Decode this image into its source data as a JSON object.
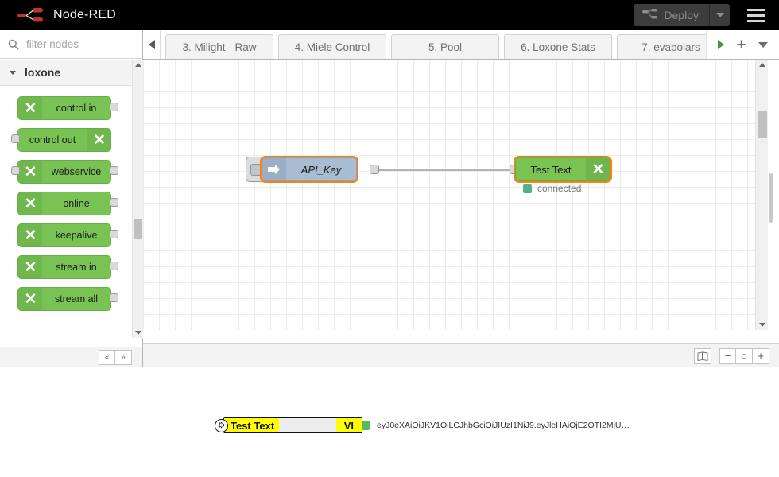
{
  "header": {
    "brand_title": "Node-RED",
    "logo_icon": "node-red-logo-icon",
    "deploy_label": "Deploy",
    "deploy_icon": "deploy-nodes-icon",
    "deploy_caret_icon": "chevron-down-icon",
    "menu_icon": "hamburger-menu-icon",
    "background_color": "#000000",
    "deploy_button_color": "#3c3c3c",
    "deploy_text_color": "#8d8d8d"
  },
  "palette": {
    "search": {
      "placeholder": "filter nodes",
      "value": "",
      "icon": "search-icon"
    },
    "category": {
      "label": "loxone",
      "chevron_icon": "chevron-down-icon",
      "expanded": true
    },
    "node_color": "#78c353",
    "nodes": [
      {
        "label": "control in",
        "icon": "loxone-x-icon",
        "icon_side": "left",
        "has_input": false,
        "has_output": true
      },
      {
        "label": "control out",
        "icon": "loxone-x-icon",
        "icon_side": "right",
        "has_input": true,
        "has_output": false
      },
      {
        "label": "webservice",
        "icon": "loxone-x-icon",
        "icon_side": "left",
        "has_input": true,
        "has_output": true
      },
      {
        "label": "online",
        "icon": "loxone-x-icon",
        "icon_side": "left",
        "has_input": false,
        "has_output": true
      },
      {
        "label": "keepalive",
        "icon": "loxone-x-icon",
        "icon_side": "left",
        "has_input": false,
        "has_output": true
      },
      {
        "label": "stream in",
        "icon": "loxone-x-icon",
        "icon_side": "left",
        "has_input": false,
        "has_output": true
      },
      {
        "label": "stream all",
        "icon": "loxone-x-icon",
        "icon_side": "left",
        "has_input": false,
        "has_output": true
      }
    ],
    "footer": {
      "collapse_all_label": "«",
      "expand_all_label": "»",
      "collapse_all_icon": "collapse-all-icon",
      "expand_all_icon": "expand-all-icon"
    },
    "scrollbar": {
      "up_icon": "scroll-up-arrow-icon",
      "down_icon": "scroll-down-arrow-icon"
    }
  },
  "tabbar": {
    "scroll_left_icon": "scroll-left-arrow-icon",
    "scroll_right_icon": "scroll-right-arrow-icon",
    "tabs": [
      {
        "label": "3. Milight - Raw",
        "active": false
      },
      {
        "label": "4. Miele Control",
        "active": false
      },
      {
        "label": "5. Pool",
        "active": false
      },
      {
        "label": "6. Loxone Stats",
        "active": false
      },
      {
        "label": "7. evapolars",
        "active": false,
        "clipped": true
      }
    ],
    "add_tab_label": "+",
    "add_tab_icon": "plus-icon",
    "tab_menu_icon": "chevron-down-icon"
  },
  "canvas": {
    "grid_size_px": 20,
    "nodes": [
      {
        "id": "inject",
        "label": "API_Key",
        "type": "inject",
        "color": "#a8bcd2",
        "icon": "inject-arrow-icon",
        "selected": true,
        "italic": true,
        "button_icon": "inject-trigger-button-icon"
      },
      {
        "id": "debug",
        "label": "Test Text",
        "type": "loxone-webservice",
        "color": "#78c353",
        "icon": "loxone-x-icon",
        "selected": true,
        "status_text": "connected",
        "status_color": "#53b189"
      }
    ],
    "wire_color": "#b3b3b3",
    "footer": {
      "navigator_icon": "navigator-map-icon",
      "zoom_out_label": "−",
      "zoom_out_icon": "zoom-out-icon",
      "zoom_reset_label": "○",
      "zoom_reset_icon": "zoom-reset-icon",
      "zoom_in_label": "+",
      "zoom_in_icon": "zoom-in-icon"
    },
    "scrollbars": {
      "left_arrow_icon": "scroll-left-arrow-icon",
      "right_arrow_icon": "scroll-right-arrow-icon",
      "up_arrow_icon": "scroll-up-arrow-icon",
      "down_arrow_icon": "scroll-down-arrow-icon"
    }
  },
  "highlight_strip": {
    "gear_icon": "gear-icon",
    "gear_glyph": "⚙",
    "node_label": "Test Text",
    "badge_label": "VI",
    "port_icon": "output-port-icon",
    "token_text": "eyJ0eXAiOiJKV1QiLCJhbGciOiJIUzI1NiJ9.eyJleHAiOjE2OTI2MjU…",
    "highlight_color": "#ffff00"
  }
}
